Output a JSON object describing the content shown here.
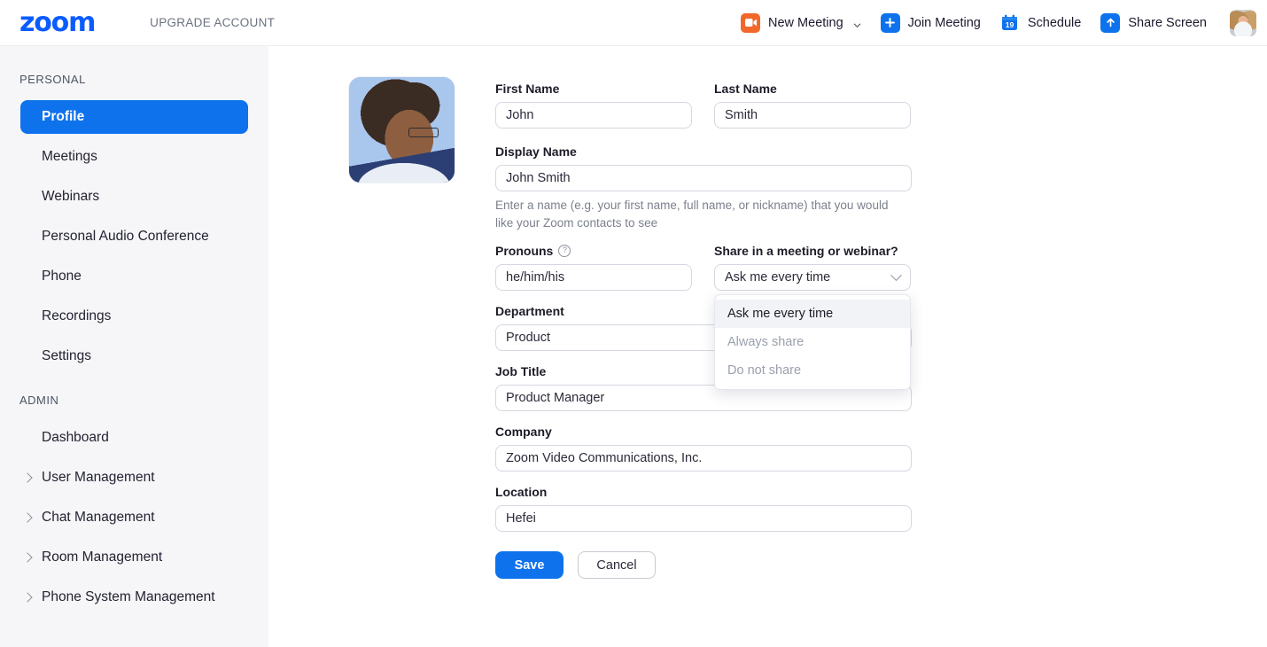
{
  "header": {
    "logo_text": "zoom",
    "upgrade_label": "UPGRADE ACCOUNT",
    "nav": [
      {
        "label": "New Meeting",
        "icon": "video-camera-icon",
        "icon_color": "#f2682a",
        "has_chevron": true
      },
      {
        "label": "Join Meeting",
        "icon": "plus-icon",
        "icon_color": "#0e72ed",
        "has_chevron": false
      },
      {
        "label": "Schedule",
        "icon": "calendar-icon",
        "icon_day": "19",
        "icon_color": "#0e72ed",
        "has_chevron": false
      },
      {
        "label": "Share Screen",
        "icon": "upload-arrow-icon",
        "icon_color": "#0e72ed",
        "has_chevron": false
      }
    ],
    "avatar_alt": "user-avatar"
  },
  "sidebar": {
    "personal_label": "PERSONAL",
    "admin_label": "ADMIN",
    "personal_items": [
      {
        "label": "Profile",
        "active": true,
        "expandable": false
      },
      {
        "label": "Meetings",
        "active": false,
        "expandable": false
      },
      {
        "label": "Webinars",
        "active": false,
        "expandable": false
      },
      {
        "label": "Personal Audio Conference",
        "active": false,
        "expandable": false
      },
      {
        "label": "Phone",
        "active": false,
        "expandable": false
      },
      {
        "label": "Recordings",
        "active": false,
        "expandable": false
      },
      {
        "label": "Settings",
        "active": false,
        "expandable": false
      }
    ],
    "admin_items": [
      {
        "label": "Dashboard",
        "active": false,
        "expandable": false
      },
      {
        "label": "User Management",
        "active": false,
        "expandable": true
      },
      {
        "label": "Chat Management",
        "active": false,
        "expandable": true
      },
      {
        "label": "Room Management",
        "active": false,
        "expandable": true
      },
      {
        "label": "Phone System Management",
        "active": false,
        "expandable": true
      }
    ]
  },
  "profile": {
    "avatar_alt": "profile-photo",
    "first_name": {
      "label": "First Name",
      "value": "John"
    },
    "last_name": {
      "label": "Last Name",
      "value": "Smith"
    },
    "display_name": {
      "label": "Display Name",
      "value": "John Smith",
      "hint": "Enter a name (e.g. your first name, full name, or nickname) that you would like your Zoom contacts to see"
    },
    "pronouns": {
      "label": "Pronouns",
      "value": "he/him/his",
      "help_icon": "question-mark-icon",
      "help_glyph": "?"
    },
    "share_setting": {
      "label": "Share in a meeting or webinar?",
      "selected": "Ask me every time",
      "open": true,
      "options": [
        {
          "label": "Ask me every time",
          "selected": true
        },
        {
          "label": "Always share",
          "selected": false
        },
        {
          "label": "Do not share",
          "selected": false
        }
      ]
    },
    "department": {
      "label": "Department",
      "value": "Product"
    },
    "job_title": {
      "label": "Job Title",
      "value": "Product Manager"
    },
    "company": {
      "label": "Company",
      "value": "Zoom Video Communications, Inc."
    },
    "location": {
      "label": "Location",
      "value": "Hefei"
    },
    "save_label": "Save",
    "cancel_label": "Cancel"
  },
  "colors": {
    "accent_blue": "#0e72ed",
    "accent_orange": "#f2682a",
    "sidebar_bg": "#f6f6f8",
    "logo_blue": "#0b5cff"
  }
}
